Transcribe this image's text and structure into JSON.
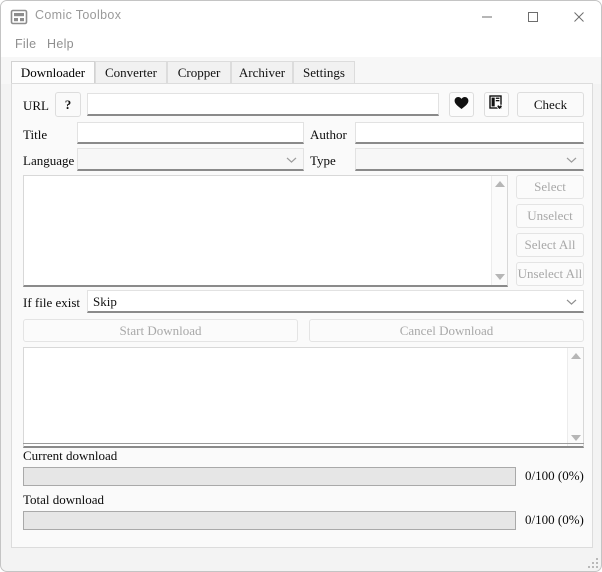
{
  "window": {
    "title": "Comic Toolbox",
    "app_icon": "comic-panels-icon",
    "minimize_label": "Minimize",
    "maximize_label": "Maximize",
    "close_label": "Close"
  },
  "menubar": {
    "items": [
      {
        "label": "File"
      },
      {
        "label": "Help"
      }
    ]
  },
  "tabs": [
    {
      "label": "Downloader",
      "active": true
    },
    {
      "label": "Converter",
      "active": false
    },
    {
      "label": "Cropper",
      "active": false
    },
    {
      "label": "Archiver",
      "active": false
    },
    {
      "label": "Settings",
      "active": false
    }
  ],
  "downloader": {
    "url_row": {
      "label": "URL",
      "help_button_label": "?",
      "url_value": "",
      "url_placeholder": "",
      "favorite_icon": "heart-icon",
      "bookmark_icon": "document-favorite-icon",
      "check_label": "Check"
    },
    "meta": {
      "title_label": "Title",
      "title_value": "",
      "author_label": "Author",
      "author_value": "",
      "language_label": "Language",
      "language_value": "",
      "type_label": "Type",
      "type_value": ""
    },
    "selection_buttons": [
      {
        "label": "Select",
        "disabled": true
      },
      {
        "label": "Unselect",
        "disabled": true
      },
      {
        "label": "Select All",
        "disabled": true
      },
      {
        "label": "Unselect All",
        "disabled": true
      }
    ],
    "chapter_list": {
      "items": []
    },
    "if_file_exist": {
      "label": "If file exist",
      "value": "Skip"
    },
    "download_buttons": [
      {
        "label": "Start Download",
        "disabled": true
      },
      {
        "label": "Cancel Download",
        "disabled": true
      }
    ],
    "log": {
      "lines": []
    },
    "progress": [
      {
        "label": "Current download",
        "value_text": "0/100 (0%)",
        "percent": 0
      },
      {
        "label": "Total download",
        "value_text": "0/100 (0%)",
        "percent": 0
      }
    ]
  }
}
